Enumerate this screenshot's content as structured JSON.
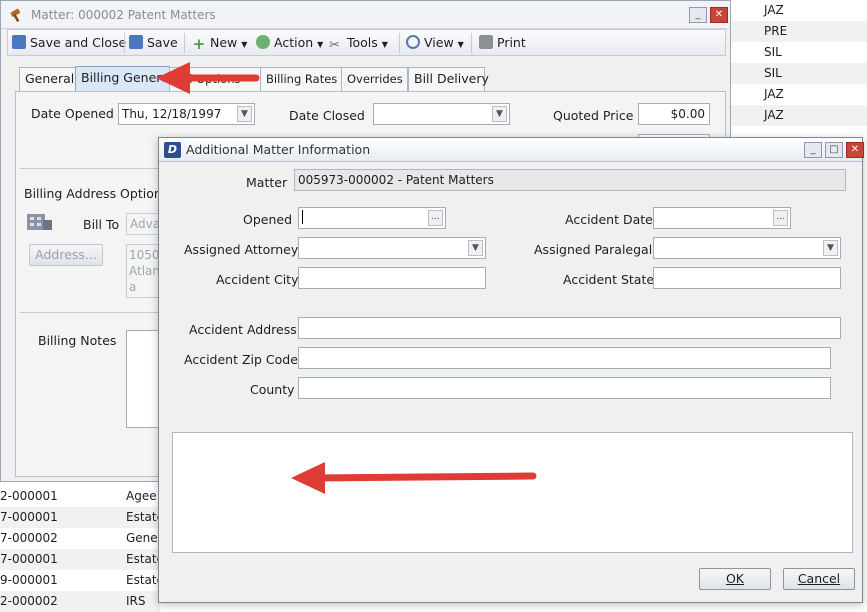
{
  "background_right_list": [
    "JAZ",
    "PRE",
    "SIL",
    "SIL",
    "JAZ",
    "JAZ"
  ],
  "background_left_rows": [
    {
      "c1": "2-000001",
      "c2": "Agee"
    },
    {
      "c1": "7-000001",
      "c2": "Estate"
    },
    {
      "c1": "7-000002",
      "c2": "Gene"
    },
    {
      "c1": "7-000001",
      "c2": "Estate"
    },
    {
      "c1": "9-000001",
      "c2": "Estate"
    },
    {
      "c1": "2-000002",
      "c2": "IRS"
    }
  ],
  "matter_window": {
    "title": "Matter: 000002 Patent Matters",
    "toolbar": {
      "save_close": "Save and Close",
      "save": "Save",
      "new": "New",
      "action": "Action",
      "tools": "Tools",
      "view": "View",
      "print": "Print"
    },
    "tabs": [
      "General",
      "Billing General",
      "Bill Options",
      "Billing Rates",
      "Overrides",
      "Bill Delivery"
    ],
    "date_opened_label": "Date Opened",
    "date_opened_value": "Thu, 12/18/1997",
    "date_closed_label": "Date Closed",
    "quoted_price_label": "Quoted Price",
    "quoted_price_value": "$0.00",
    "billing_address_options": "Billing Address Options",
    "bill_to_label": "Bill To",
    "bill_to_value": "Adva",
    "address_button": "Address...",
    "address_lines": [
      "1050",
      "Atlan",
      "a"
    ],
    "billing_notes_label": "Billing Notes"
  },
  "dialog": {
    "title": "Additional Matter Information",
    "matter_label": "Matter",
    "matter_value": "005973-000002 - Patent Matters",
    "opened_label": "Opened",
    "accident_date_label": "Accident Date",
    "assigned_attorney_label": "Assigned Attorney",
    "assigned_paralegal_label": "Assigned Paralegal",
    "accident_city_label": "Accident City",
    "accident_state_label": "Accident State",
    "accident_address_label": "Accident Address",
    "accident_zip_label": "Accident Zip Code",
    "county_label": "County",
    "ok": "OK",
    "cancel": "Cancel"
  },
  "annotation_color": "#e03c36"
}
